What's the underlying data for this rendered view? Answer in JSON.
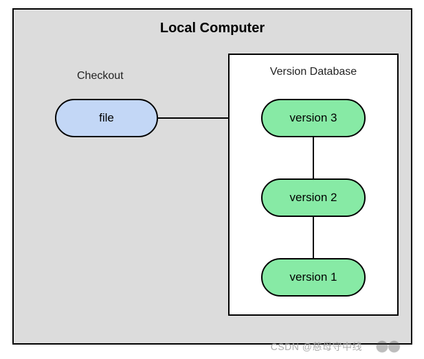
{
  "diagram": {
    "title": "Local Computer",
    "checkout": {
      "label": "Checkout",
      "file": "file"
    },
    "version_database": {
      "label": "Version Database",
      "versions": [
        "version 3",
        "version 2",
        "version 1"
      ]
    }
  },
  "watermark": "CSDN @慈母守中线",
  "chart_data": {
    "type": "diagram",
    "title": "Local Computer",
    "nodes": [
      {
        "id": "file",
        "label": "file",
        "group": "Checkout"
      },
      {
        "id": "v3",
        "label": "version 3",
        "group": "Version Database"
      },
      {
        "id": "v2",
        "label": "version 2",
        "group": "Version Database"
      },
      {
        "id": "v1",
        "label": "version 1",
        "group": "Version Database"
      }
    ],
    "edges": [
      {
        "from": "file",
        "to": "v3"
      },
      {
        "from": "v3",
        "to": "v2"
      },
      {
        "from": "v2",
        "to": "v1"
      }
    ],
    "containers": [
      {
        "id": "local",
        "label": "Local Computer",
        "children": [
          "checkout",
          "vdb"
        ]
      },
      {
        "id": "checkout",
        "label": "Checkout",
        "children": [
          "file"
        ]
      },
      {
        "id": "vdb",
        "label": "Version Database",
        "children": [
          "v3",
          "v2",
          "v1"
        ]
      }
    ]
  }
}
